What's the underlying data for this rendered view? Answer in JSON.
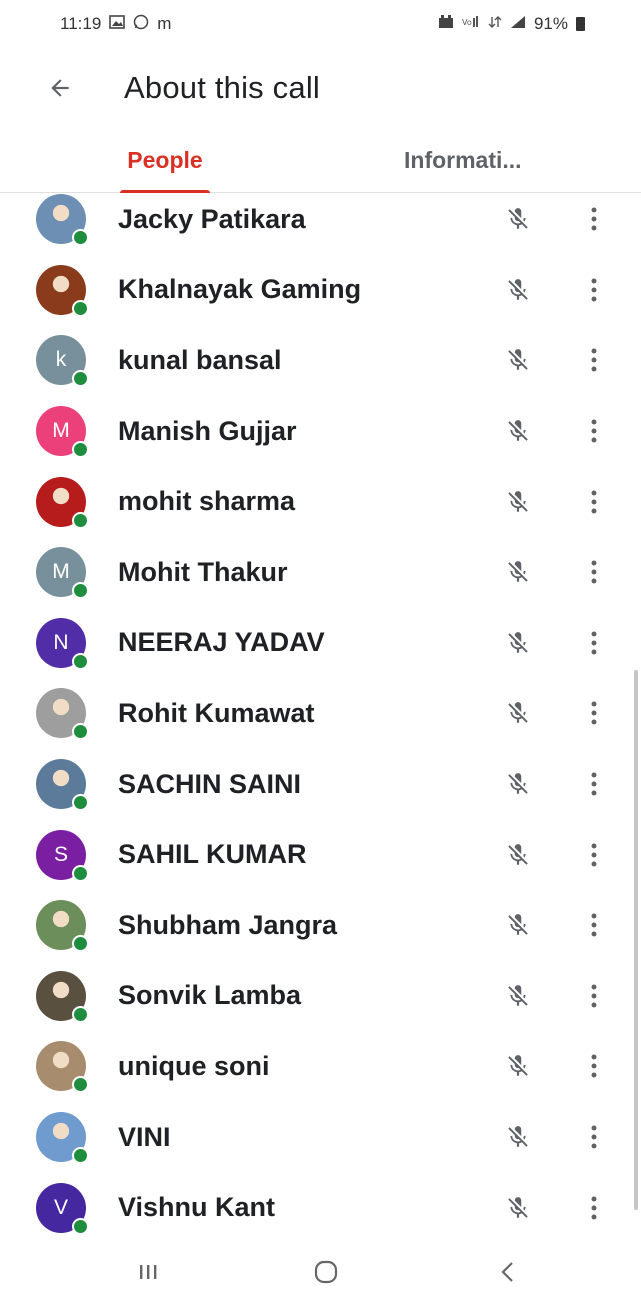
{
  "status_bar": {
    "time": "11:19",
    "left_icons": [
      "gallery-icon",
      "whatsapp-icon"
    ],
    "left_letter": "m",
    "right_icons": [
      "alarm-icon",
      "volte-icon",
      "data-icon",
      "signal-icon"
    ],
    "battery": "91%"
  },
  "header": {
    "title": "About this call"
  },
  "tabs": [
    {
      "label": "People",
      "active": true
    },
    {
      "label": "Informati...",
      "active": false
    }
  ],
  "people": [
    {
      "name": "Jacky Patikara",
      "avatar_type": "photo",
      "initial": "",
      "color": "#6d8fb3",
      "muted": true
    },
    {
      "name": "Khalnayak Gaming",
      "avatar_type": "photo",
      "initial": "",
      "color": "#8a3b1c",
      "muted": true
    },
    {
      "name": "kunal bansal",
      "avatar_type": "initial",
      "initial": "k",
      "color": "#78909c",
      "muted": true
    },
    {
      "name": "Manish Gujjar",
      "avatar_type": "initial",
      "initial": "M",
      "color": "#ec407a",
      "muted": true
    },
    {
      "name": "mohit sharma",
      "avatar_type": "photo",
      "initial": "",
      "color": "#b71c1c",
      "muted": true
    },
    {
      "name": "Mohit Thakur",
      "avatar_type": "initial",
      "initial": "M",
      "color": "#78909c",
      "muted": true
    },
    {
      "name": "NEERAJ YADAV",
      "avatar_type": "initial",
      "initial": "N",
      "color": "#512da8",
      "muted": true
    },
    {
      "name": "Rohit Kumawat",
      "avatar_type": "photo",
      "initial": "",
      "color": "#9e9e9e",
      "muted": true
    },
    {
      "name": "SACHIN SAINI",
      "avatar_type": "photo",
      "initial": "",
      "color": "#5c7a9a",
      "muted": true
    },
    {
      "name": "SAHIL KUMAR",
      "avatar_type": "initial",
      "initial": "S",
      "color": "#7b1fa2",
      "muted": true
    },
    {
      "name": "Shubham Jangra",
      "avatar_type": "photo",
      "initial": "",
      "color": "#6b8e5a",
      "muted": true
    },
    {
      "name": "Sonvik Lamba",
      "avatar_type": "photo",
      "initial": "",
      "color": "#5a5040",
      "muted": true
    },
    {
      "name": "unique soni",
      "avatar_type": "photo",
      "initial": "",
      "color": "#a88c6e",
      "muted": true
    },
    {
      "name": "VINI",
      "avatar_type": "photo",
      "initial": "",
      "color": "#6f9bcf",
      "muted": true
    },
    {
      "name": "Vishnu Kant",
      "avatar_type": "initial",
      "initial": "V",
      "color": "#4527a0",
      "muted": true
    }
  ],
  "nav_bar": {
    "buttons": [
      "recent-apps-icon",
      "home-icon",
      "back-nav-icon"
    ]
  },
  "colors": {
    "accent": "#d93025",
    "presence": "#1e8e3e"
  }
}
